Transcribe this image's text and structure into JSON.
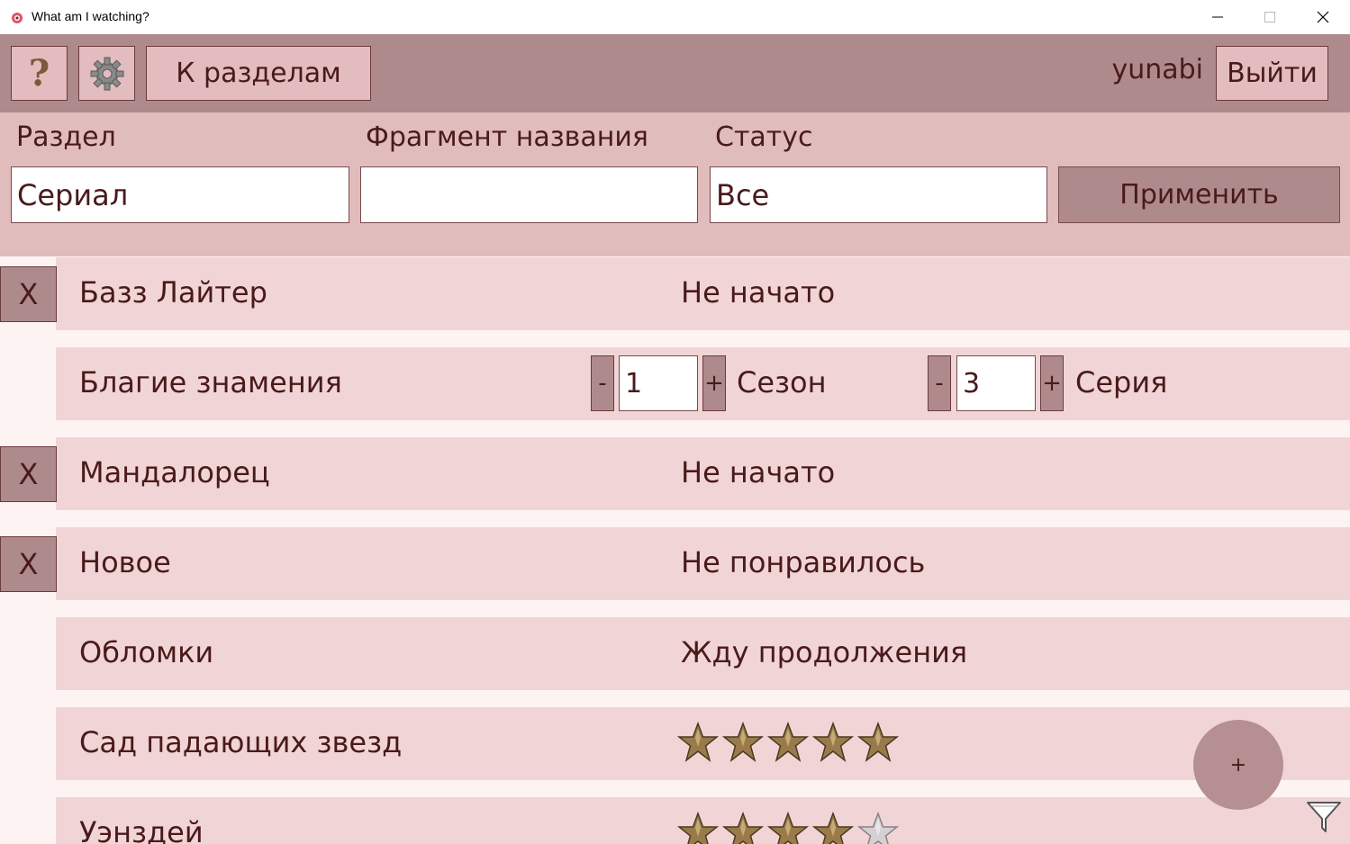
{
  "window": {
    "title": "What am I watching?"
  },
  "toolbar": {
    "help_label": "?",
    "sections_label": "К разделам",
    "username": "yunabi",
    "logout_label": "Выйти"
  },
  "filters": {
    "section_label": "Раздел",
    "section_value": "Сериал",
    "name_label": "Фрагмент названия",
    "name_value": "",
    "status_label": "Статус",
    "status_value": "Все",
    "apply_label": "Применить"
  },
  "list": {
    "delete_label": "X",
    "items": [
      {
        "title": "Базз Лайтер",
        "status": "Не начато"
      },
      {
        "title": "Благие знамения",
        "season": "1",
        "season_label": "Сезон",
        "episode": "3",
        "episode_label": "Серия",
        "minus": "-",
        "plus": "+"
      },
      {
        "title": "Мандалорец",
        "status": "Не начато"
      },
      {
        "title": "Новое",
        "status": "Не понравилось"
      },
      {
        "title": "Обломки",
        "status": "Жду продолжения"
      },
      {
        "title": "Сад падающих звезд",
        "rating": 5
      },
      {
        "title": "Уэнздей",
        "rating": 4
      }
    ]
  },
  "fab": {
    "label": "+"
  },
  "colors": {
    "toolbar": "#ae8a8c",
    "filters": "#e1bcbd",
    "row": "#f1d5d6",
    "text": "#4a1a1a"
  }
}
